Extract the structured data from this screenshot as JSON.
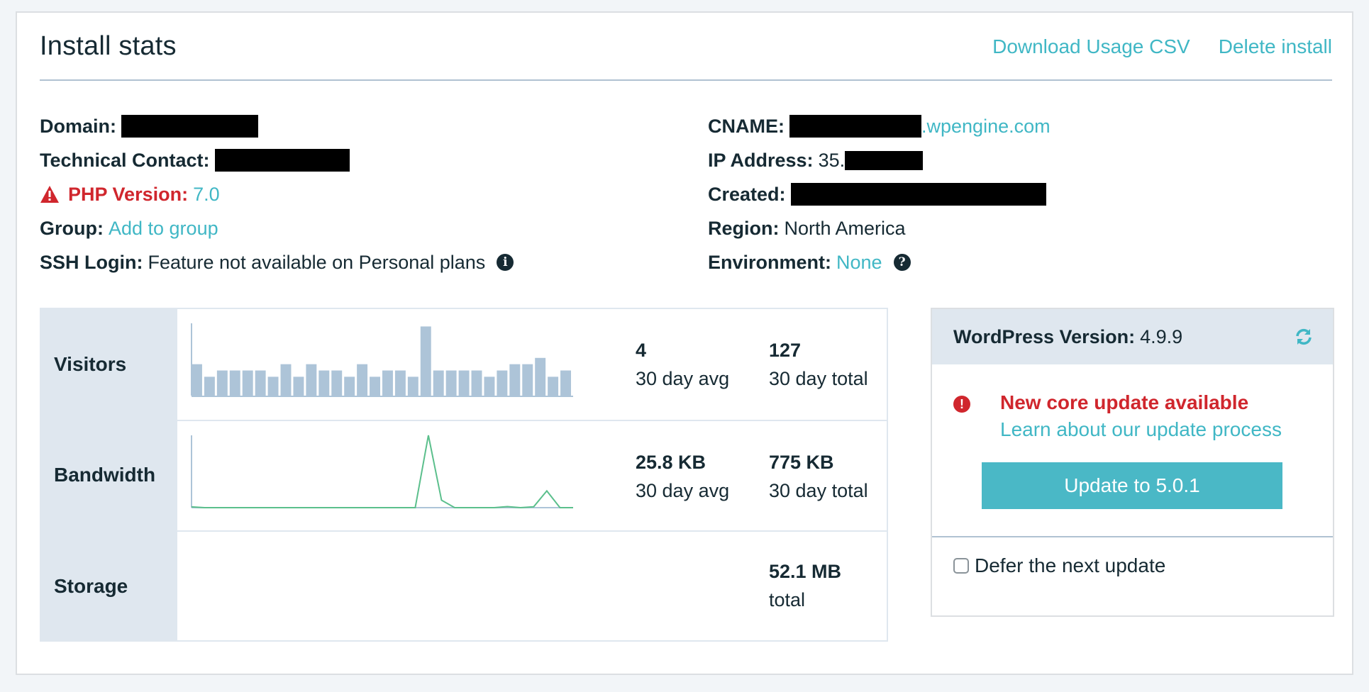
{
  "header": {
    "title": "Install stats",
    "links": [
      "Download Usage CSV",
      "Delete install"
    ]
  },
  "info_left": {
    "domain_label": "Domain:",
    "technical_contact_label": "Technical Contact:",
    "php_label": "PHP Version:",
    "php_value": "7.0",
    "group_label": "Group:",
    "group_link": "Add to group",
    "ssh_label": "SSH Login:",
    "ssh_value": "Feature not available on Personal plans"
  },
  "info_right": {
    "cname_label": "CNAME:",
    "cname_suffix": ".wpengine.com",
    "ip_label": "IP Address:",
    "ip_prefix": "35.",
    "created_label": "Created:",
    "region_label": "Region:",
    "region_value": "North America",
    "environment_label": "Environment:",
    "environment_value": "None"
  },
  "icons": {
    "php_warning": "warning-triangle-icon",
    "ssh_info": "info-circle-icon",
    "environment_help": "question-circle-icon",
    "wp_refresh": "refresh-icon",
    "update_alert": "exclamation-circle-icon"
  },
  "stats": {
    "rows": [
      {
        "label": "Visitors",
        "avg_value": "4",
        "avg_label": "30 day avg",
        "total_value": "127",
        "total_label": "30 day total"
      },
      {
        "label": "Bandwidth",
        "avg_value": "25.8 KB",
        "avg_label": "30 day avg",
        "total_value": "775 KB",
        "total_label": "30 day total"
      },
      {
        "label": "Storage",
        "total_value": "52.1 MB",
        "total_label": "total"
      }
    ]
  },
  "wordpress": {
    "version_label": "WordPress Version:",
    "version_value": "4.9.9",
    "alert_title": "New core update available",
    "alert_link": "Learn about our update process",
    "update_button": "Update to 5.0.1",
    "defer_label": "Defer the next update",
    "defer_checked": false
  },
  "colors": {
    "accent": "#40b7c5",
    "button": "#4ab8c6",
    "danger": "#d0262d",
    "text": "#162a33",
    "panel_bg": "#dfe7ef",
    "bar": "#adc4d8",
    "line": "#5bbf8c"
  },
  "chart_data": [
    {
      "type": "bar",
      "title": "Visitors",
      "categories": [
        "1",
        "2",
        "3",
        "4",
        "5",
        "6",
        "7",
        "8",
        "9",
        "10",
        "11",
        "12",
        "13",
        "14",
        "15",
        "16",
        "17",
        "18",
        "19",
        "20",
        "21",
        "22",
        "23",
        "24",
        "25",
        "26",
        "27",
        "28",
        "29",
        "30"
      ],
      "values": [
        5,
        3,
        4,
        4,
        4,
        4,
        3,
        5,
        3,
        5,
        4,
        4,
        3,
        5,
        3,
        4,
        4,
        3,
        11,
        4,
        4,
        4,
        4,
        3,
        4,
        5,
        5,
        6,
        3,
        4
      ],
      "xlabel": "",
      "ylabel": "",
      "ylim": [
        0,
        11.5
      ]
    },
    {
      "type": "line",
      "title": "Bandwidth",
      "x": [
        "1",
        "2",
        "3",
        "4",
        "5",
        "6",
        "7",
        "8",
        "9",
        "10",
        "11",
        "12",
        "13",
        "14",
        "15",
        "16",
        "17",
        "18",
        "19",
        "20",
        "21",
        "22",
        "23",
        "24",
        "25",
        "26",
        "27",
        "28",
        "29",
        "30"
      ],
      "values": [
        6,
        0,
        0,
        0,
        0,
        0,
        0,
        0,
        0,
        0,
        0,
        0,
        0,
        0,
        0,
        0,
        0,
        0,
        565,
        58,
        0,
        0,
        0,
        0,
        8,
        0,
        7,
        131,
        0,
        0
      ],
      "units": "KB",
      "xlabel": "",
      "ylabel": "",
      "ylim": [
        0,
        565
      ]
    }
  ]
}
